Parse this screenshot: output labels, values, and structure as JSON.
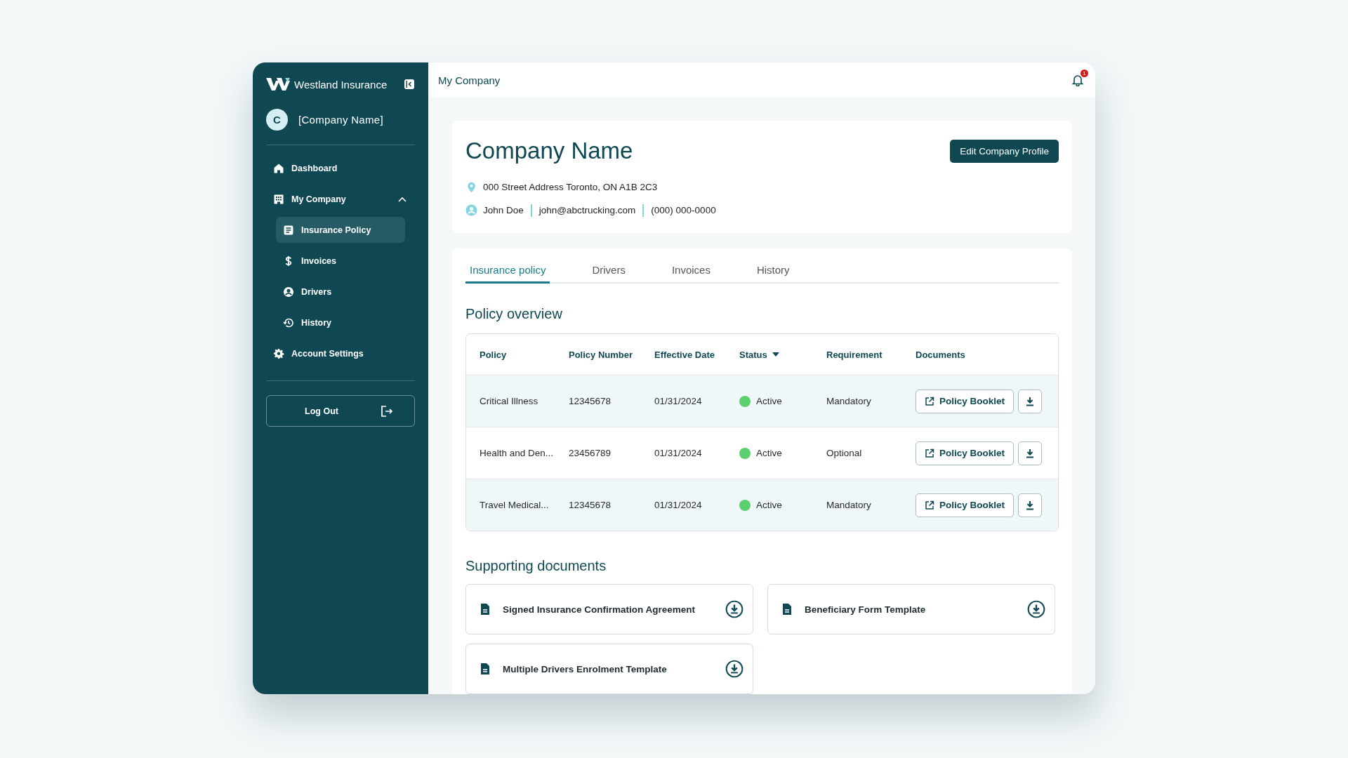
{
  "sidebar": {
    "brand": "Westland Insurance",
    "avatar_initial": "C",
    "company": "[Company Name]",
    "nav": [
      {
        "label": "Dashboard",
        "kind": "home",
        "selected": false
      },
      {
        "label": "My Company",
        "kind": "building",
        "selected": false,
        "expanded": true,
        "children": [
          {
            "label": "Insurance Policy",
            "kind": "doc",
            "selected": true
          },
          {
            "label": "Invoices",
            "kind": "dollar",
            "selected": false
          },
          {
            "label": "Drivers",
            "kind": "user",
            "selected": false
          },
          {
            "label": "History",
            "kind": "history",
            "selected": false
          }
        ]
      },
      {
        "label": "Account Settings",
        "kind": "gear",
        "selected": false
      }
    ],
    "logout": "Log Out"
  },
  "topbar": {
    "title": "My Company",
    "notification_count": "1"
  },
  "company": {
    "name": "Company Name",
    "edit_button": "Edit Company Profile",
    "address": "000 Street Address Toronto, ON A1B 2C3",
    "contact": "John Doe",
    "email": "john@abctrucking.com",
    "phone": "(000) 000-0000"
  },
  "tabs": [
    {
      "label": "Insurance policy",
      "selected": true
    },
    {
      "label": "Drivers",
      "selected": false
    },
    {
      "label": "Invoices",
      "selected": false
    },
    {
      "label": "History",
      "selected": false
    }
  ],
  "policy_overview": {
    "title": "Policy overview",
    "columns": [
      {
        "label": "Policy",
        "sorted": false
      },
      {
        "label": "Policy Number",
        "sorted": false
      },
      {
        "label": "Effective Date",
        "sorted": false
      },
      {
        "label": "Status",
        "sorted": true
      },
      {
        "label": "Requirement",
        "sorted": false
      },
      {
        "label": "Documents",
        "sorted": false
      }
    ],
    "rows": [
      {
        "policy": "Critical Illness",
        "number": "12345678",
        "date": "01/31/2024",
        "status": "Active",
        "color": "#5ccf6f",
        "requirement": "Mandatory",
        "document": "Policy Booklet"
      },
      {
        "policy": "Health and Den...",
        "number": "23456789",
        "date": "01/31/2024",
        "status": "Active",
        "color": "#5ccf6f",
        "requirement": "Optional",
        "document": "Policy Booklet"
      },
      {
        "policy": "Travel Medical...",
        "number": "12345678",
        "date": "01/31/2024",
        "status": "Active",
        "color": "#5ccf6f",
        "requirement": "Mandatory",
        "document": "Policy Booklet"
      }
    ]
  },
  "supporting_documents": {
    "title": "Supporting documents",
    "items": [
      "Signed Insurance Confirmation Agreement",
      "Beneficiary Form Template",
      "Multiple Drivers Enrolment Template"
    ]
  }
}
